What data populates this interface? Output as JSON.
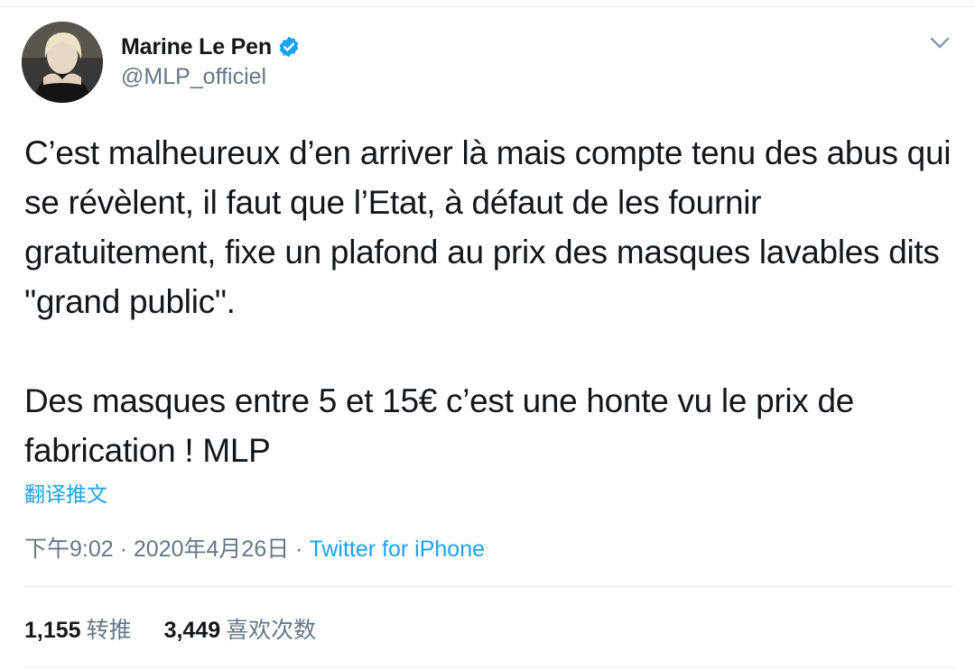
{
  "author": {
    "display_name": "Marine Le Pen",
    "handle": "@MLP_officiel",
    "verified": true
  },
  "tweet": {
    "paragraphs": [
      "C’est malheureux d’en arriver là mais compte tenu des abus qui se révèlent, il faut que l’Etat, à défaut de les fournir gratuitement, fixe un plafond au prix des masques lavables dits \"grand public\".",
      "Des masques entre 5 et 15€ c’est une honte vu le prix de fabrication ! MLP"
    ],
    "translate_label": "翻译推文",
    "time": "下午9:02",
    "separator": "·",
    "date": "2020年4月26日",
    "source": "Twitter for iPhone"
  },
  "stats": {
    "retweets_count": "1,155",
    "retweets_label": "转推",
    "likes_count": "3,449",
    "likes_label": "喜欢次数"
  },
  "icons": {
    "verified": "verified-badge-icon",
    "caret": "chevron-down-icon"
  },
  "colors": {
    "accent": "#1da1f2",
    "muted": "#657786",
    "text": "#14171a",
    "divider": "#e6ecf0"
  }
}
